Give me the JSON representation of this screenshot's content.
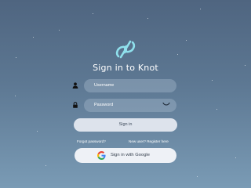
{
  "app": {
    "title": "Sign in to Knot"
  },
  "form": {
    "username": {
      "placeholder": "Username",
      "value": "",
      "icon": "user-icon"
    },
    "password": {
      "placeholder": "Password",
      "value": "",
      "icon": "lock-icon",
      "toggle_icon": "eye-icon"
    },
    "signin_label": "Sign in",
    "forgot_label": "Forgot password?",
    "register_label": "New user? Register here",
    "google_label": "Sign in with Google"
  },
  "colors": {
    "background_top": "#4f6580",
    "background_bottom": "#7a9bb5",
    "accent": "#8fe0ec",
    "button_bg": "#dde3ec"
  }
}
